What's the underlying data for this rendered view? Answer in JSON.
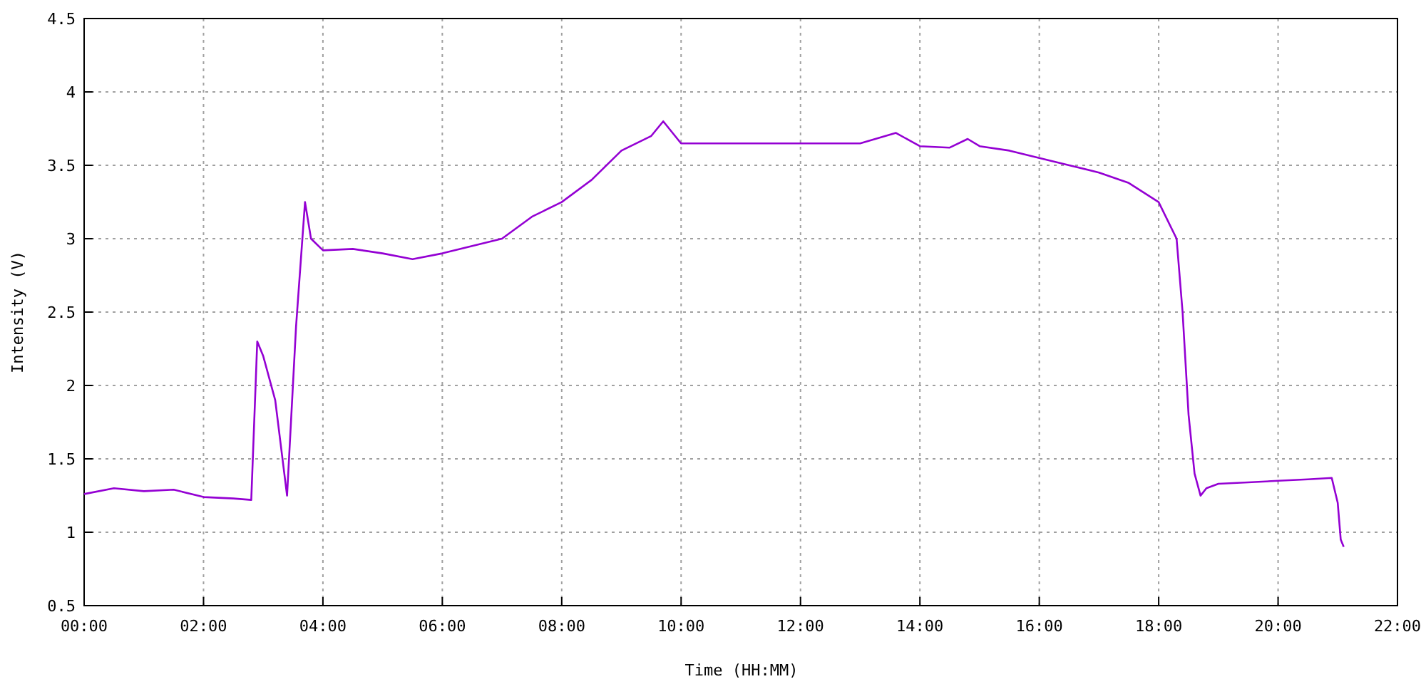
{
  "chart_data": {
    "type": "line",
    "xlabel": "Time (HH:MM)",
    "ylabel": "Intensity (V)",
    "x": [
      0,
      0.5,
      1,
      1.5,
      2,
      2.5,
      2.8,
      2.9,
      3.0,
      3.2,
      3.4,
      3.55,
      3.7,
      3.8,
      4,
      4.5,
      5,
      5.5,
      6,
      6.5,
      7,
      7.5,
      8,
      8.5,
      9,
      9.5,
      9.7,
      10,
      10.5,
      11,
      12,
      13,
      13.6,
      14,
      14.5,
      14.8,
      15,
      15.5,
      16,
      16.5,
      17,
      17.5,
      18,
      18.3,
      18.4,
      18.5,
      18.6,
      18.7,
      18.8,
      19,
      19.5,
      20,
      20.5,
      20.9,
      21,
      21.05,
      21.1
    ],
    "series": [
      {
        "color": "#9400d3",
        "values": [
          1.26,
          1.3,
          1.28,
          1.29,
          1.24,
          1.23,
          1.22,
          2.3,
          2.2,
          1.9,
          1.25,
          2.4,
          3.25,
          3.0,
          2.92,
          2.93,
          2.9,
          2.86,
          2.9,
          2.95,
          3.0,
          3.15,
          3.25,
          3.4,
          3.6,
          3.7,
          3.8,
          3.65,
          3.65,
          3.65,
          3.65,
          3.65,
          3.72,
          3.63,
          3.62,
          3.68,
          3.63,
          3.6,
          3.55,
          3.5,
          3.45,
          3.38,
          3.25,
          3.0,
          2.5,
          1.8,
          1.4,
          1.25,
          1.3,
          1.33,
          1.34,
          1.35,
          1.36,
          1.37,
          1.2,
          0.95,
          0.9
        ]
      }
    ],
    "grid": true,
    "xlim": [
      0,
      22
    ],
    "ylim": [
      0.5,
      4.5
    ],
    "xticks": [
      {
        "value": 0,
        "label": "00:00"
      },
      {
        "value": 2,
        "label": "02:00"
      },
      {
        "value": 4,
        "label": "04:00"
      },
      {
        "value": 6,
        "label": "06:00"
      },
      {
        "value": 8,
        "label": "08:00"
      },
      {
        "value": 10,
        "label": "10:00"
      },
      {
        "value": 12,
        "label": "12:00"
      },
      {
        "value": 14,
        "label": "14:00"
      },
      {
        "value": 16,
        "label": "16:00"
      },
      {
        "value": 18,
        "label": "18:00"
      },
      {
        "value": 20,
        "label": "20:00"
      },
      {
        "value": 22,
        "label": "22:00"
      }
    ],
    "yticks": [
      {
        "value": 0.5,
        "label": "0.5"
      },
      {
        "value": 1,
        "label": "1"
      },
      {
        "value": 1.5,
        "label": "1.5"
      },
      {
        "value": 2,
        "label": "2"
      },
      {
        "value": 2.5,
        "label": "2.5"
      },
      {
        "value": 3,
        "label": "3"
      },
      {
        "value": 3.5,
        "label": "3.5"
      },
      {
        "value": 4,
        "label": "4"
      },
      {
        "value": 4.5,
        "label": "4.5"
      }
    ]
  }
}
